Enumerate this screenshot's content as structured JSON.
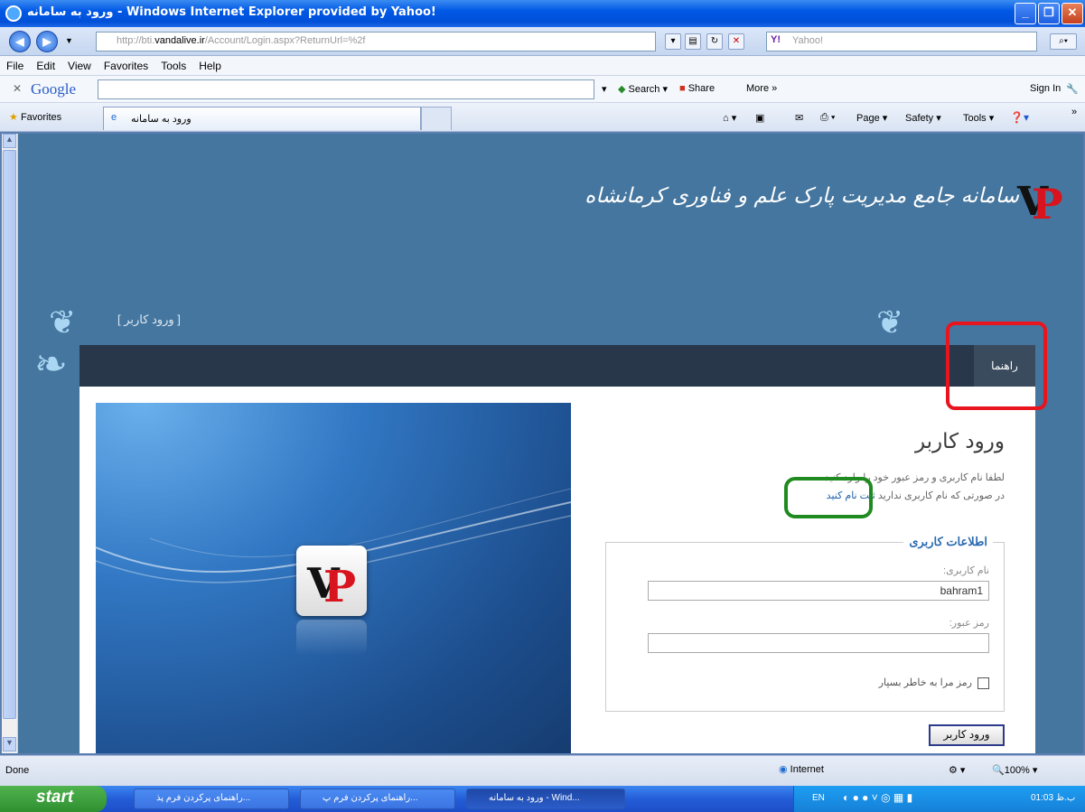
{
  "window": {
    "title": "ورود به سامانه - Windows Internet Explorer provided by Yahoo!"
  },
  "address_bar": {
    "url_prefix": "http://bti.",
    "url_host": "vandalive.ir",
    "url_path": "/Account/Login.aspx?ReturnUrl=%2f",
    "search_placeholder": "Yahoo!"
  },
  "menu": [
    "File",
    "Edit",
    "View",
    "Favorites",
    "Tools",
    "Help"
  ],
  "google_bar": {
    "brand": "Google",
    "search_label": "Search",
    "share_label": "Share",
    "more_label": "More »",
    "signin_label": "Sign In"
  },
  "favorites_bar": {
    "favorites_label": "Favorites",
    "tab_title": "ورود به سامانه",
    "page_label": "Page",
    "safety_label": "Safety",
    "tools_label": "Tools"
  },
  "site": {
    "logo_text": "سامانه جامع مدیریت پارک علم و فناوری کرمانشاه",
    "breadcrumb": "[ ورود کاربر ]",
    "help_tab": "راهنما",
    "login_title": "ورود کاربر",
    "line1": "لطفا نام کاربری و رمز عبور خود را وارد کنید.",
    "line2_prefix": "در صورتی که نام کاربری ندارید ",
    "line2_link": "ثبت نام کنید",
    "fieldset_legend": "اطلاعات کاربری",
    "username_label": "نام کاربری:",
    "username_value": "bahram1",
    "password_label": "رمز عبور:",
    "password_value": "",
    "remember_label": "رمز مرا به خاطر بسپار",
    "login_button": "ورود کاربر"
  },
  "status_bar": {
    "status": "Done",
    "zone": "Internet",
    "zoom": "100%"
  },
  "taskbar": {
    "start": "start",
    "items": [
      "راهنمای پرکردن فرم پذ...",
      "راهنمای پرکردن فرم پ...",
      "ورود به سامانه - Wind..."
    ],
    "lang": "EN",
    "clock": "01:03 ب.ظ"
  },
  "colors": {
    "page_bg": "#45769f",
    "panel_bar": "#28384a",
    "highlight_red": "#e8141e",
    "highlight_green": "#1f8a1f",
    "legend_blue": "#2a6ab0"
  }
}
